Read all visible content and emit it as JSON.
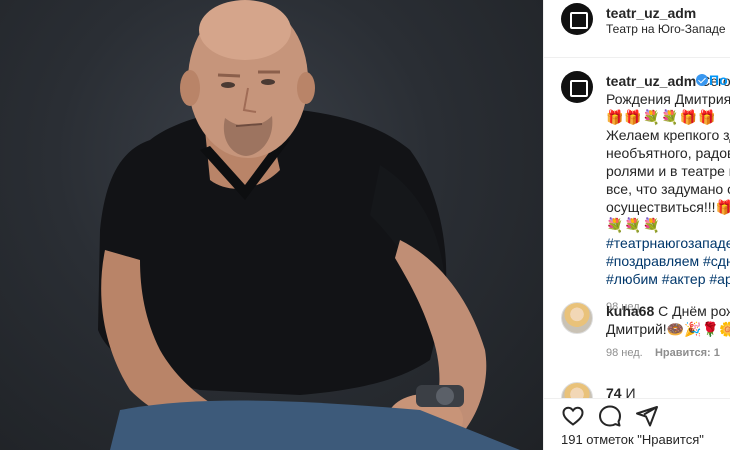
{
  "post": {
    "account": "teatr_uz_adm",
    "location": "Театр на Юго-Западе",
    "follow_label": "По",
    "caption_lines": [
      "Сегод",
      "Рождения Дмитрия",
      "🎁🎁💐💐🎁🎁",
      "Желаем крепкого зд",
      "необъятного, радова",
      "ролями и в театре и",
      "все, что задумано об",
      "осуществиться!!!🎁🎁",
      "💐💐💐"
    ],
    "hashtag_lines": [
      "#театрнаюгозападе",
      "#поздравляем #сдне",
      "#любим #актер #арт"
    ],
    "caption_time": "98 нед.",
    "likes_text": "191 отметок \"Нравится\""
  },
  "comments": [
    {
      "user": "kuha68",
      "line1": "С Днём рожд",
      "line2": "Дмитрий!🍩🎉🌹🌼",
      "time": "98 нед.",
      "likes": "Нравится: 1",
      "reply": "О"
    },
    {
      "user_partial": "74",
      "text_partial": "И"
    }
  ],
  "icons": {
    "like": "heart-icon",
    "comment": "comment-icon",
    "share": "share-icon",
    "verified": "verified-badge-icon"
  },
  "colors": {
    "background_photo": "#2a2e34",
    "link_blue": "#0095f6",
    "hashtag": "#00376b",
    "meta_gray": "#8e8e8e",
    "verified": "#3897f0"
  }
}
